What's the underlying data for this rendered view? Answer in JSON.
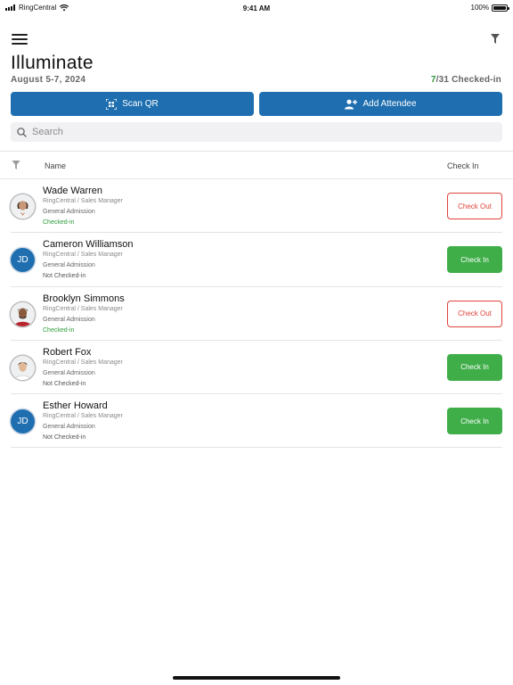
{
  "status_bar": {
    "carrier": "RingCentral",
    "time": "9:41 AM",
    "battery": "100%"
  },
  "header": {
    "title": "Illuminate",
    "date": "August 5-7, 2024",
    "checked_in_count": "7",
    "checked_in_rest": "/31 Checked-in"
  },
  "actions": {
    "scan_label": "Scan QR",
    "add_label": "Add Attendee"
  },
  "search": {
    "placeholder": "Search"
  },
  "table": {
    "col_name": "Name",
    "col_check": "Check In",
    "rows": [
      {
        "name": "Wade Warren",
        "role": "RingCentral / Sales Manager",
        "ticket": "General Admission",
        "status": "Checked-in",
        "action": "Check Out",
        "avatar": "photo"
      },
      {
        "name": "Cameron Williamson",
        "role": "RingCentral / Sales Manager",
        "ticket": "General Admission",
        "status": "Not Checked-in",
        "action": "Check In",
        "avatar_initials": "JD"
      },
      {
        "name": "Brooklyn Simmons",
        "role": "RingCentral / Sales Manager",
        "ticket": "General Admission",
        "status": "Checked-in",
        "action": "Check Out",
        "avatar": "photo"
      },
      {
        "name": "Robert Fox",
        "role": "RingCentral / Sales Manager",
        "ticket": "General Admission",
        "status": "Not Checked-in",
        "action": "Check In",
        "avatar": "photo"
      },
      {
        "name": "Esther Howard",
        "role": "RingCentral / Sales Manager",
        "ticket": "General Admission",
        "status": "Not Checked-in",
        "action": "Check In",
        "avatar_initials": "JD"
      }
    ]
  },
  "colors": {
    "primary": "#1f6fb0",
    "success": "#3fae49",
    "danger": "#e0433a",
    "checked_text": "#2d9b3a"
  },
  "icons": [
    "hamburger-menu-icon",
    "filter-icon",
    "qr-scan-icon",
    "add-person-icon",
    "search-icon",
    "wifi-icon",
    "signal-icon",
    "battery-icon"
  ]
}
